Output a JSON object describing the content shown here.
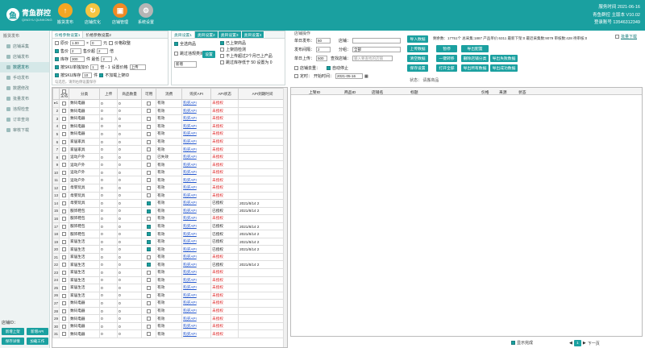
{
  "header": {
    "logo_text": "青鱼群控",
    "logo_sub": "QINGYU QUNKONG",
    "logo_glyph": "鱼",
    "nav": [
      {
        "label": "搬货发布",
        "icon": "upload-icon",
        "color": "#f5a623"
      },
      {
        "label": "店铺优化",
        "icon": "refresh-icon",
        "color": "#f5c542"
      },
      {
        "label": "店铺管理",
        "icon": "store-icon",
        "color": "#f08a24"
      },
      {
        "label": "系统设置",
        "icon": "gear-icon",
        "color": "#b5b5b5"
      }
    ],
    "time": "服务时间 2021-06-16",
    "info": [
      "青鱼群控 主版本 V10.02",
      "登录账号 13546312349"
    ]
  },
  "sidebar": {
    "title": "搬货发布",
    "items": [
      "店铺采集",
      "店铺发布",
      "数据发布",
      "手动发布",
      "数据修改",
      "批量发布",
      "违规检查",
      "订单查询",
      "审核下载"
    ],
    "footer_label": "店铺ID：",
    "buttons": [
      "新增上架",
      "新增API",
      "保存详情",
      "加载工作"
    ]
  },
  "left_panel": {
    "tabs": [
      "价格参数设置1",
      "价格参数设置2"
    ],
    "rows": [
      {
        "label": "原价",
        "v1": "1.00",
        "op": "×",
        "v2": "0",
        "unit": "元",
        "extra": "价格取整"
      },
      {
        "label": "售价",
        "v1": "2",
        "op": "售价超",
        "v2": "2",
        "unit": "倍"
      },
      {
        "label": "库存",
        "v1": "300",
        "op": "件 最低",
        "v2": "2",
        "unit": "人"
      },
      {
        "label": "按SKU单独加价",
        "v1": "1",
        "op": "倍 - 1",
        "v2": "设置价格",
        "unit": "上传"
      },
      {
        "label": "按SKU库存",
        "v1": "10",
        "op": "件",
        "v2": "不加载上架ID",
        "unit": ""
      }
    ],
    "note": "勾选后，请到右侧设置保存"
  },
  "mid_panel": {
    "tabs": [
      "类目设置1",
      "类目设置2",
      "类目设置3",
      "类目设置4"
    ],
    "checks": [
      "全选商品",
      "跳过违规类目"
    ],
    "btn": "设置",
    "select": "新增",
    "options": [
      "已上架商品",
      "上架前检测",
      "不上传超过2个月已上产品",
      "跳过库存低于 50 设置为 0"
    ]
  },
  "right_form": {
    "title": "店铺操作",
    "f1": "单日发布：",
    "f1v": "50",
    "f1b": "店铺：",
    "f2": "发布间隔：",
    "f2v": "2",
    "f2b": "分组：",
    "f2c": "全部",
    "f3": "单日上传：",
    "f3v": "500",
    "f3b": "查找店铺：",
    "f3c": "输入要查找的店铺",
    "f4": "店铺去重：",
    "f4b": "自动停止",
    "f5": "定时：",
    "f5b": "开始时间：",
    "f5c": "2021-05-16",
    "status": "状态： 请搬商品"
  },
  "action_buttons": [
    "导入数据",
    "上传数据",
    "清空数据",
    "保存设置",
    "暂停",
    "一键转移",
    "打开全部",
    "导出配置",
    "删除店铺分类",
    "导出所有数据",
    "导出失败数据",
    "导出成功数据"
  ],
  "stats": "剩余数：17751个  总采集:1887 产品单价:6311 最新下架:0 最近采集数:9079 审核数:428 待审核:0",
  "collect_btn": "批量下载",
  "table": {
    "headers": [
      "全选",
      "分类",
      "上传",
      "商品数量",
      "可用",
      "消费",
      "购买API",
      "API状态",
      "API到期时间"
    ],
    "rows": [
      {
        "cat": "数码电器",
        "up": "0",
        "qty": "0",
        "use": false,
        "st": "有效",
        "api": "购买API",
        "as": "未授权",
        "exp": ""
      },
      {
        "cat": "数码电器",
        "up": "0",
        "qty": "0",
        "use": false,
        "st": "有效",
        "api": "购买API",
        "as": "未授权",
        "exp": ""
      },
      {
        "cat": "数码电器",
        "up": "0",
        "qty": "0",
        "use": false,
        "st": "有效",
        "api": "购买API",
        "as": "未授权",
        "exp": ""
      },
      {
        "cat": "数码电器",
        "up": "0",
        "qty": "0",
        "use": false,
        "st": "有效",
        "api": "购买API",
        "as": "未授权",
        "exp": ""
      },
      {
        "cat": "数码电器",
        "up": "0",
        "qty": "0",
        "use": false,
        "st": "有效",
        "api": "购买API",
        "as": "未授权",
        "exp": ""
      },
      {
        "cat": "家居家具",
        "up": "0",
        "qty": "0",
        "use": false,
        "st": "有效",
        "api": "购买API",
        "as": "未授权",
        "exp": ""
      },
      {
        "cat": "家居家具",
        "up": "0",
        "qty": "0",
        "use": false,
        "st": "有效",
        "api": "购买API",
        "as": "未授权",
        "exp": ""
      },
      {
        "cat": "运动户外",
        "up": "0",
        "qty": "0",
        "use": false,
        "st": "已失效",
        "api": "购买API",
        "as": "未授权",
        "exp": ""
      },
      {
        "cat": "运动户外",
        "up": "0",
        "qty": "0",
        "use": false,
        "st": "有效",
        "api": "购买API",
        "as": "未授权",
        "exp": ""
      },
      {
        "cat": "运动户外",
        "up": "0",
        "qty": "0",
        "use": false,
        "st": "有效",
        "api": "购买API",
        "as": "未授权",
        "exp": ""
      },
      {
        "cat": "运动户外",
        "up": "0",
        "qty": "0",
        "use": false,
        "st": "有效",
        "api": "购买API",
        "as": "未授权",
        "exp": ""
      },
      {
        "cat": "母婴玩具",
        "up": "0",
        "qty": "0",
        "use": false,
        "st": "有效",
        "api": "购买API",
        "as": "未授权",
        "exp": ""
      },
      {
        "cat": "母婴玩具",
        "up": "0",
        "qty": "0",
        "use": false,
        "st": "有效",
        "api": "购买API",
        "as": "未授权",
        "exp": ""
      },
      {
        "cat": "母婴玩具",
        "up": "0",
        "qty": "0",
        "use": true,
        "st": "有效",
        "api": "购买API",
        "as": "已授权",
        "exp": "2021/6/14 2"
      },
      {
        "cat": "服饰鞋包",
        "up": "0",
        "qty": "0",
        "use": true,
        "st": "有效",
        "api": "购买API",
        "as": "已授权",
        "exp": "2021/6/14 2"
      },
      {
        "cat": "服饰鞋包",
        "up": "0",
        "qty": "0",
        "use": false,
        "st": "有效",
        "api": "购买API",
        "as": "未授权",
        "exp": ""
      },
      {
        "cat": "服饰鞋包",
        "up": "0",
        "qty": "0",
        "use": true,
        "st": "有效",
        "api": "购买API",
        "as": "已授权",
        "exp": "2021/6/14 2"
      },
      {
        "cat": "服饰鞋包",
        "up": "0",
        "qty": "0",
        "use": true,
        "st": "有效",
        "api": "购买API",
        "as": "已授权",
        "exp": "2021/6/14 2"
      },
      {
        "cat": "家居生活",
        "up": "0",
        "qty": "0",
        "use": true,
        "st": "有效",
        "api": "购买API",
        "as": "已授权",
        "exp": "2021/6/14 2"
      },
      {
        "cat": "家居生活",
        "up": "0",
        "qty": "0",
        "use": true,
        "st": "有效",
        "api": "购买API",
        "as": "已授权",
        "exp": "2021/6/14 2"
      },
      {
        "cat": "家居生活",
        "up": "0",
        "qty": "0",
        "use": false,
        "st": "有效",
        "api": "购买API",
        "as": "未授权",
        "exp": ""
      },
      {
        "cat": "家居生活",
        "up": "0",
        "qty": "0",
        "use": true,
        "st": "有效",
        "api": "购买API",
        "as": "已授权",
        "exp": "2021/6/14 2"
      },
      {
        "cat": "家居生活",
        "up": "0",
        "qty": "0",
        "use": false,
        "st": "有效",
        "api": "购买API",
        "as": "未授权",
        "exp": ""
      },
      {
        "cat": "家居生活",
        "up": "0",
        "qty": "0",
        "use": false,
        "st": "有效",
        "api": "购买API",
        "as": "未授权",
        "exp": ""
      },
      {
        "cat": "家居生活",
        "up": "0",
        "qty": "0",
        "use": false,
        "st": "有效",
        "api": "购买API",
        "as": "未授权",
        "exp": ""
      },
      {
        "cat": "家居生活",
        "up": "0",
        "qty": "0",
        "use": false,
        "st": "有效",
        "api": "购买API",
        "as": "未授权",
        "exp": ""
      },
      {
        "cat": "数码电器",
        "up": "0",
        "qty": "0",
        "use": false,
        "st": "有效",
        "api": "购买API",
        "as": "未授权",
        "exp": ""
      },
      {
        "cat": "数码电器",
        "up": "0",
        "qty": "0",
        "use": false,
        "st": "有效",
        "api": "购买API",
        "as": "未授权",
        "exp": ""
      },
      {
        "cat": "数码电器",
        "up": "0",
        "qty": "0",
        "use": false,
        "st": "有效",
        "api": "购买API",
        "as": "未授权",
        "exp": ""
      },
      {
        "cat": "数码电器",
        "up": "0",
        "qty": "0",
        "use": false,
        "st": "有效",
        "api": "购买API",
        "as": "未授权",
        "exp": ""
      },
      {
        "cat": "数码电器",
        "up": "0",
        "qty": "0",
        "use": false,
        "st": "有效",
        "api": "购买API",
        "as": "未授权",
        "exp": ""
      }
    ]
  },
  "right_table": {
    "headers": [
      "上架ID",
      "商品ID",
      "店铺名",
      "标题",
      "价格",
      "来源",
      "状态"
    ]
  },
  "bottom": {
    "label": "显示完成",
    "page": "1",
    "next": "下一页"
  }
}
